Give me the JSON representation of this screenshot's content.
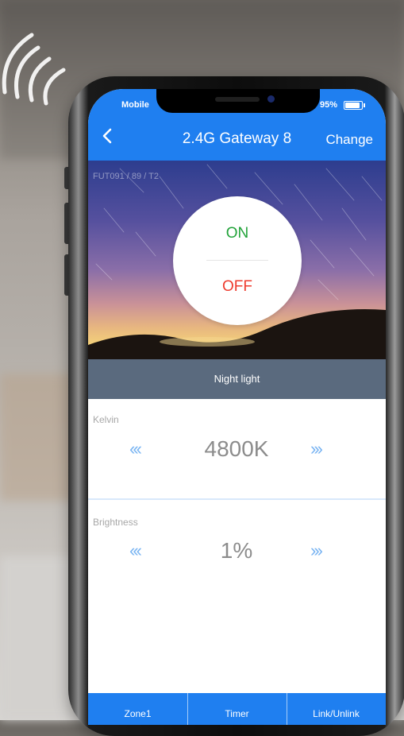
{
  "status_bar": {
    "carrier": "Mobile",
    "battery": "95%"
  },
  "nav": {
    "back_icon": "chevron-left-icon",
    "title": "2.4G Gateway 8",
    "change_label": "Change"
  },
  "hero": {
    "model_label": "FUT091 / 89 / T2",
    "on_label": "ON",
    "off_label": "OFF"
  },
  "mode_bar": {
    "label": "Night light"
  },
  "kelvin": {
    "label": "Kelvin",
    "decrease_icon": "‹‹‹",
    "value": "4800K",
    "increase_icon": "›››"
  },
  "brightness": {
    "label": "Brightness",
    "decrease_icon": "‹‹‹",
    "value": "1%",
    "increase_icon": "›››"
  },
  "tab_bar": {
    "tabs": [
      {
        "label": "Zone1"
      },
      {
        "label": "Timer"
      },
      {
        "label": "Link/Unlink"
      }
    ]
  },
  "colors": {
    "accent": "#1f7ff0",
    "on": "#22a33a",
    "off": "#ee3b2e",
    "mode_bar": "#5a6a7e"
  }
}
